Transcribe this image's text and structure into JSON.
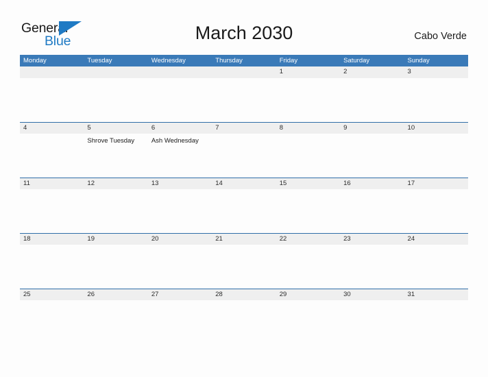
{
  "brand": {
    "name_part1": "General",
    "name_part2": "Blue",
    "flag_icon": "blue-triangle-flag",
    "accent_color": "#1f7ac4"
  },
  "header": {
    "title": "March 2030",
    "region": "Cabo Verde"
  },
  "colors": {
    "weekday_header_bg": "#3a7ab8",
    "date_band_bg": "#efefef",
    "date_band_border": "#2f6da8",
    "page_bg": "#fdfdfd",
    "text": "#1a1a1a"
  },
  "calendar": {
    "weekdays": [
      "Monday",
      "Tuesday",
      "Wednesday",
      "Thursday",
      "Friday",
      "Saturday",
      "Sunday"
    ],
    "weeks": [
      {
        "days": [
          {
            "date": "",
            "event": ""
          },
          {
            "date": "",
            "event": ""
          },
          {
            "date": "",
            "event": ""
          },
          {
            "date": "",
            "event": ""
          },
          {
            "date": "1",
            "event": ""
          },
          {
            "date": "2",
            "event": ""
          },
          {
            "date": "3",
            "event": ""
          }
        ]
      },
      {
        "days": [
          {
            "date": "4",
            "event": ""
          },
          {
            "date": "5",
            "event": "Shrove Tuesday"
          },
          {
            "date": "6",
            "event": "Ash Wednesday"
          },
          {
            "date": "7",
            "event": ""
          },
          {
            "date": "8",
            "event": ""
          },
          {
            "date": "9",
            "event": ""
          },
          {
            "date": "10",
            "event": ""
          }
        ]
      },
      {
        "days": [
          {
            "date": "11",
            "event": ""
          },
          {
            "date": "12",
            "event": ""
          },
          {
            "date": "13",
            "event": ""
          },
          {
            "date": "14",
            "event": ""
          },
          {
            "date": "15",
            "event": ""
          },
          {
            "date": "16",
            "event": ""
          },
          {
            "date": "17",
            "event": ""
          }
        ]
      },
      {
        "days": [
          {
            "date": "18",
            "event": ""
          },
          {
            "date": "19",
            "event": ""
          },
          {
            "date": "20",
            "event": ""
          },
          {
            "date": "21",
            "event": ""
          },
          {
            "date": "22",
            "event": ""
          },
          {
            "date": "23",
            "event": ""
          },
          {
            "date": "24",
            "event": ""
          }
        ]
      },
      {
        "days": [
          {
            "date": "25",
            "event": ""
          },
          {
            "date": "26",
            "event": ""
          },
          {
            "date": "27",
            "event": ""
          },
          {
            "date": "28",
            "event": ""
          },
          {
            "date": "29",
            "event": ""
          },
          {
            "date": "30",
            "event": ""
          },
          {
            "date": "31",
            "event": ""
          }
        ]
      }
    ]
  }
}
